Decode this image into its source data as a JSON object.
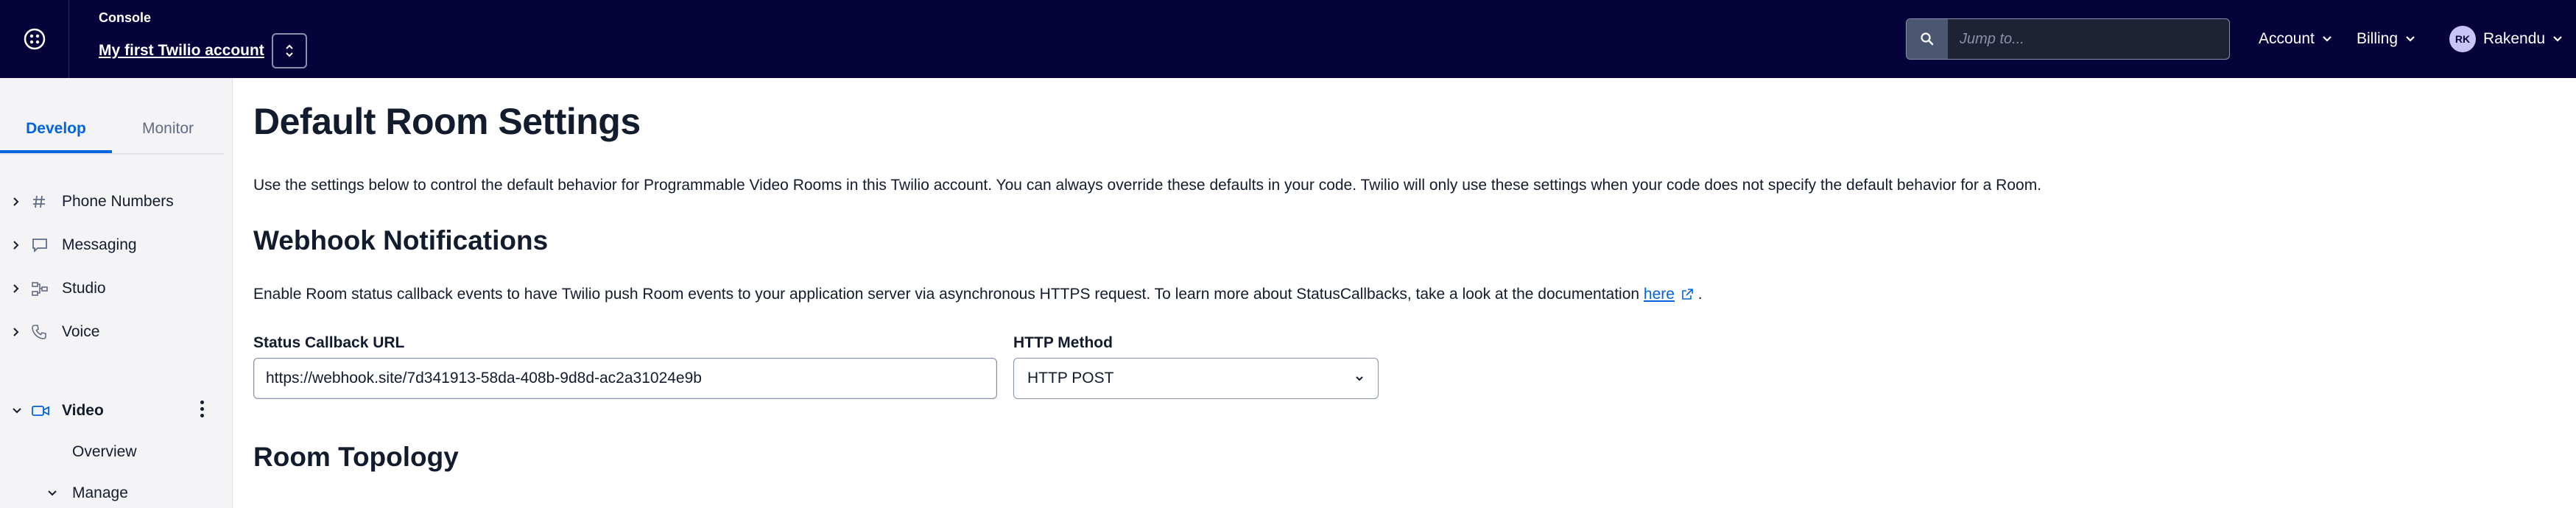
{
  "topbar": {
    "console_label": "Console",
    "account_name": "My first Twilio account",
    "search_placeholder": "Jump to...",
    "account_menu": "Account",
    "billing_menu": "Billing",
    "user_initials": "RK",
    "user_name": "Rakendu",
    "background_color": "#06033a"
  },
  "sidebar": {
    "tabs": [
      "Develop",
      "Monitor"
    ],
    "active_tab": "Develop",
    "items": [
      {
        "label": "Phone Numbers",
        "icon": "hash-icon"
      },
      {
        "label": "Messaging",
        "icon": "chat-icon"
      },
      {
        "label": "Studio",
        "icon": "flow-icon"
      },
      {
        "label": "Voice",
        "icon": "phone-icon"
      },
      {
        "label": "Video",
        "icon": "video-icon"
      }
    ],
    "sub_items": [
      "Overview",
      "Manage"
    ]
  },
  "main": {
    "title": "Default Room Settings",
    "intro": "Use the settings below to control the default behavior for Programmable Video Rooms in this Twilio account. You can always override these defaults in your code. Twilio will only use these settings when your code does not specify the default behavior for a Room.",
    "webhook_heading": "Webhook Notifications",
    "webhook_text": "Enable Room status callback events to have Twilio push Room events to your application server via asynchronous HTTPS request. To learn more about StatusCallbacks, take a look at the documentation",
    "webhook_link": "here",
    "webhook_period": ".",
    "status_callback_label": "Status Callback URL",
    "status_callback_value": "https://webhook.site/7d341913-58da-408b-9d8d-ac2a31024e9b",
    "http_method_label": "HTTP Method",
    "http_method_value": "HTTP POST",
    "topology_heading": "Room Topology",
    "link_color": "#0263e0"
  }
}
